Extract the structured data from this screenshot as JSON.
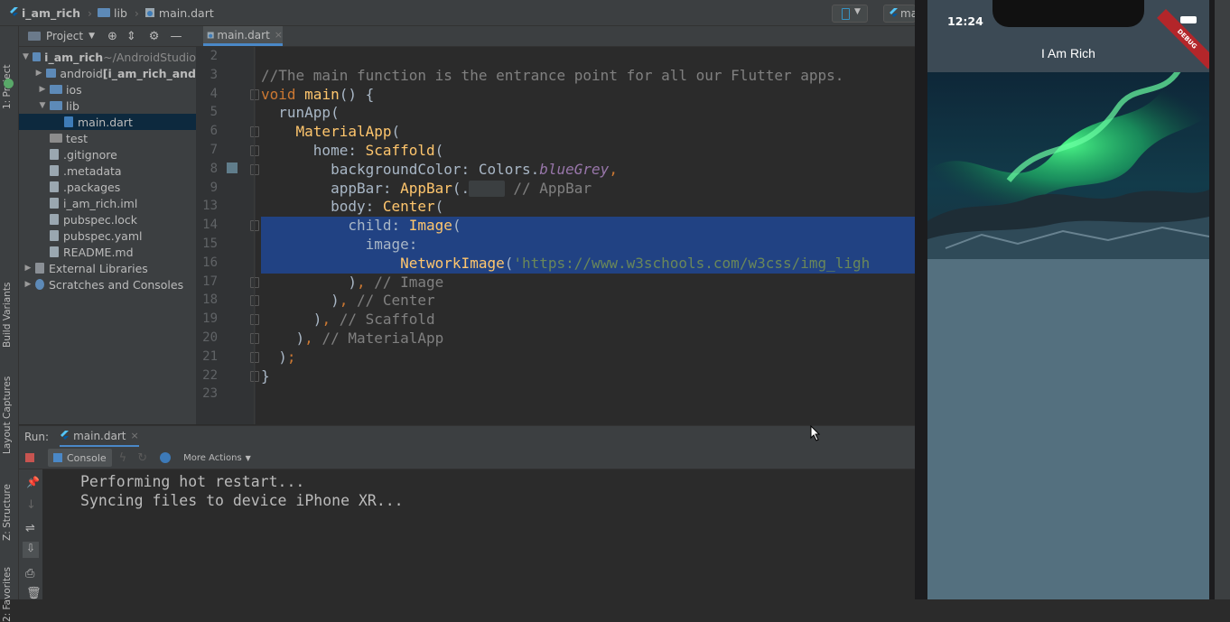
{
  "breadcrumb": {
    "project": "i_am_rich",
    "folder": "lib",
    "file": "main.dart",
    "right_file": "ma"
  },
  "left_strip": {
    "project": "1: Project",
    "build_variants": "Build Variants",
    "layout_captures": "Layout Captures",
    "structure": "Z: Structure",
    "favorites": "2: Favorites"
  },
  "project_panel": {
    "header": "Project",
    "tree": [
      {
        "label": "i_am_rich",
        "extra": "~/AndroidStudio",
        "level": 0,
        "arrow": "▼",
        "icon": "folder"
      },
      {
        "label": "android",
        "extra": "[i_am_rich_and",
        "level": 1,
        "arrow": "▶",
        "icon": "folder"
      },
      {
        "label": "ios",
        "extra": "",
        "level": 1,
        "arrow": "▶",
        "icon": "folder"
      },
      {
        "label": "lib",
        "extra": "",
        "level": 1,
        "arrow": "▼",
        "icon": "folder"
      },
      {
        "label": "main.dart",
        "extra": "",
        "level": 2,
        "arrow": "",
        "icon": "dart",
        "selected": true
      },
      {
        "label": "test",
        "extra": "",
        "level": 1,
        "arrow": "",
        "icon": "folder"
      },
      {
        "label": ".gitignore",
        "extra": "",
        "level": 1,
        "arrow": "",
        "icon": "file"
      },
      {
        "label": ".metadata",
        "extra": "",
        "level": 1,
        "arrow": "",
        "icon": "file"
      },
      {
        "label": ".packages",
        "extra": "",
        "level": 1,
        "arrow": "",
        "icon": "file"
      },
      {
        "label": "i_am_rich.iml",
        "extra": "",
        "level": 1,
        "arrow": "",
        "icon": "file"
      },
      {
        "label": "pubspec.lock",
        "extra": "",
        "level": 1,
        "arrow": "",
        "icon": "file"
      },
      {
        "label": "pubspec.yaml",
        "extra": "",
        "level": 1,
        "arrow": "",
        "icon": "file"
      },
      {
        "label": "README.md",
        "extra": "",
        "level": 1,
        "arrow": "",
        "icon": "file"
      },
      {
        "label": "External Libraries",
        "extra": "",
        "level": 0,
        "arrow": "▶",
        "icon": "lib"
      },
      {
        "label": "Scratches and Consoles",
        "extra": "",
        "level": 0,
        "arrow": "▶",
        "icon": "scratch"
      }
    ]
  },
  "editor": {
    "tab": "main.dart",
    "lines": [
      {
        "n": "2",
        "html": ""
      },
      {
        "n": "3",
        "html": "<span class='cm'>//The main function is the entrance point for all our Flutter apps.</span>"
      },
      {
        "n": "4",
        "html": "<span class='kw'>void</span> <span class='fn'>main</span>() {"
      },
      {
        "n": "5",
        "html": "  runApp("
      },
      {
        "n": "6",
        "html": "    <span class='fn'>MaterialApp</span>("
      },
      {
        "n": "7",
        "html": "      home: <span class='fn'>Scaffold</span>("
      },
      {
        "n": "8",
        "html": "        backgroundColor: Colors.<span class='it'>blueGrey</span><span class='kw'>,</span>"
      },
      {
        "n": "9",
        "html": "        appBar: <span class='fn'>AppBar</span>(...)<span class='kw'>,</span> <span class='cm'>// AppBar</span>"
      },
      {
        "n": "13",
        "html": "        body: <span class='fn'>Center</span>("
      },
      {
        "n": "14",
        "html": "          child: <span class='fn'>Image</span>("
      },
      {
        "n": "15",
        "html": "            image:"
      },
      {
        "n": "16",
        "html": "                <span class='fn'>NetworkImage</span>(<span class='str'>'https://www.w3schools.com/w3css/img_ligh</span>"
      },
      {
        "n": "17",
        "html": "          )<span class='kw'>,</span> <span class='cm'>// Image</span>"
      },
      {
        "n": "18",
        "html": "        )<span class='kw'>,</span> <span class='cm'>// Center</span>"
      },
      {
        "n": "19",
        "html": "      )<span class='kw'>,</span> <span class='cm'>// Scaffold</span>"
      },
      {
        "n": "20",
        "html": "    )<span class='kw'>,</span> <span class='cm'>// MaterialApp</span>"
      },
      {
        "n": "21",
        "html": "  )<span class='kw'>;</span>"
      },
      {
        "n": "22",
        "html": "}"
      },
      {
        "n": "23",
        "html": ""
      }
    ]
  },
  "run_panel": {
    "run_label": "Run:",
    "tab": "main.dart",
    "console_tab": "Console",
    "more_actions": "More Actions",
    "output": [
      "Performing hot restart...",
      "Syncing files to device iPhone XR..."
    ]
  },
  "simulator": {
    "time": "12:24",
    "app_title": "I Am Rich",
    "debug_banner": "DEBUG",
    "background_color": "#54707f"
  }
}
